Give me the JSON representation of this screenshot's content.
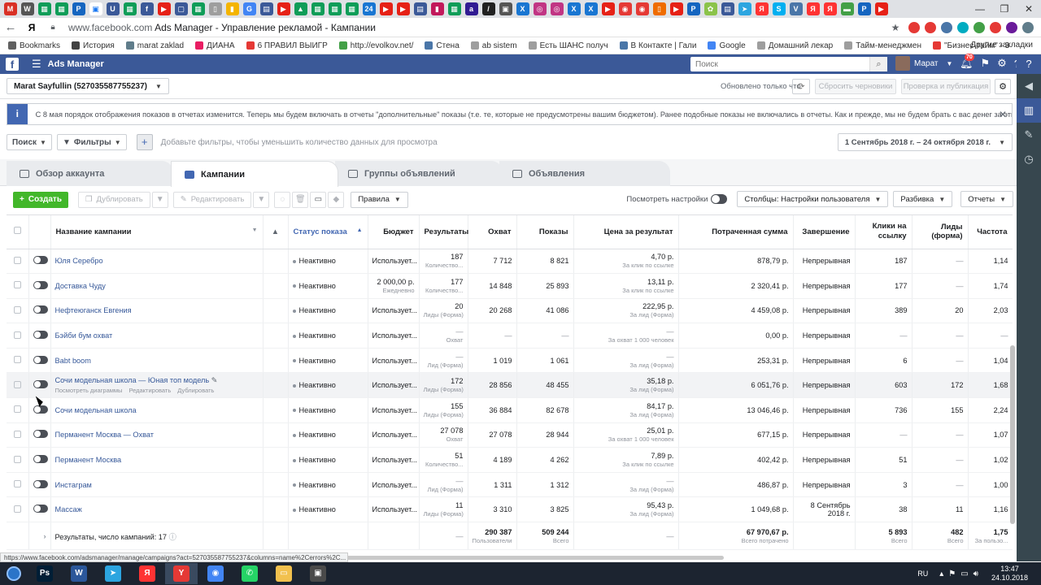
{
  "browser": {
    "tab_favicons": [
      {
        "icon": "gmail-icon",
        "color": "#d93025",
        "glyph": "M"
      },
      {
        "icon": "w-icon",
        "color": "#555555",
        "glyph": "W"
      },
      {
        "icon": "sheets-icon",
        "color": "#0f9d58",
        "glyph": "▦"
      },
      {
        "icon": "sheets-icon",
        "color": "#0f9d58",
        "glyph": "▦"
      },
      {
        "icon": "p-icon",
        "color": "#1565c0",
        "glyph": "P"
      },
      {
        "icon": "active-tab-icon",
        "color": "#1877f2",
        "glyph": "▣",
        "active": true
      },
      {
        "icon": "u-icon",
        "color": "#3b5998",
        "glyph": "U"
      },
      {
        "icon": "sheets-icon",
        "color": "#0f9d58",
        "glyph": "▦"
      },
      {
        "icon": "facebook-icon",
        "color": "#3b5998",
        "glyph": "f"
      },
      {
        "icon": "youtube-icon",
        "color": "#e62117",
        "glyph": "▶"
      },
      {
        "icon": "chat-icon",
        "color": "#3b5998",
        "glyph": "▢"
      },
      {
        "icon": "sheets-icon",
        "color": "#0f9d58",
        "glyph": "▦"
      },
      {
        "icon": "doc-icon",
        "color": "#9e9e9e",
        "glyph": "▯"
      },
      {
        "icon": "analytics-icon",
        "color": "#f4b400",
        "glyph": "▮"
      },
      {
        "icon": "google-icon",
        "color": "#4285f4",
        "glyph": "G"
      },
      {
        "icon": "cal-icon",
        "color": "#3b5998",
        "glyph": "▤"
      },
      {
        "icon": "youtube-icon",
        "color": "#e62117",
        "glyph": "▶"
      },
      {
        "icon": "drive-icon",
        "color": "#0f9d58",
        "glyph": "▲"
      },
      {
        "icon": "sheets-icon",
        "color": "#0f9d58",
        "glyph": "▦"
      },
      {
        "icon": "sheets-icon",
        "color": "#0f9d58",
        "glyph": "▦"
      },
      {
        "icon": "sheets-icon",
        "color": "#0f9d58",
        "glyph": "▦"
      },
      {
        "icon": "24-icon",
        "color": "#1976d2",
        "glyph": "24"
      },
      {
        "icon": "youtube-icon",
        "color": "#e62117",
        "glyph": "▶"
      },
      {
        "icon": "youtube-icon",
        "color": "#e62117",
        "glyph": "▶"
      },
      {
        "icon": "cal-icon",
        "color": "#3b5998",
        "glyph": "▤"
      },
      {
        "icon": "chart-icon",
        "color": "#c2185b",
        "glyph": "▮"
      },
      {
        "icon": "sheets-icon",
        "color": "#0f9d58",
        "glyph": "▦"
      },
      {
        "icon": "ab-icon",
        "color": "#311b92",
        "glyph": "a"
      },
      {
        "icon": "slash-icon",
        "color": "#212121",
        "glyph": "/"
      },
      {
        "icon": "lock-icon",
        "color": "#555555",
        "glyph": "▣"
      },
      {
        "icon": "x-icon",
        "color": "#1976d2",
        "glyph": "X"
      },
      {
        "icon": "instagram-icon",
        "color": "#c13584",
        "glyph": "◎"
      },
      {
        "icon": "instagram-icon",
        "color": "#c13584",
        "glyph": "◎"
      },
      {
        "icon": "x-icon",
        "color": "#1976d2",
        "glyph": "X"
      },
      {
        "icon": "x-icon",
        "color": "#1976d2",
        "glyph": "X"
      },
      {
        "icon": "youtube-icon",
        "color": "#e62117",
        "glyph": "▶"
      },
      {
        "icon": "record-icon",
        "color": "#e53935",
        "glyph": "◉"
      },
      {
        "icon": "record-icon",
        "color": "#e53935",
        "glyph": "◉"
      },
      {
        "icon": "bag-icon",
        "color": "#ef6c00",
        "glyph": "▯"
      },
      {
        "icon": "youtube-icon",
        "color": "#e62117",
        "glyph": "▶"
      },
      {
        "icon": "p-icon",
        "color": "#1565c0",
        "glyph": "P"
      },
      {
        "icon": "photos-icon",
        "color": "#8bc34a",
        "glyph": "✿"
      },
      {
        "icon": "cal-icon",
        "color": "#3b5998",
        "glyph": "▤"
      },
      {
        "icon": "telegram-icon",
        "color": "#2ca5e0",
        "glyph": "➤"
      },
      {
        "icon": "yandex-icon",
        "color": "#ff3333",
        "glyph": "Я"
      },
      {
        "icon": "skype-icon",
        "color": "#00aff0",
        "glyph": "S"
      },
      {
        "icon": "vk-icon",
        "color": "#4a76a8",
        "glyph": "V"
      },
      {
        "icon": "yandex-icon",
        "color": "#ff3333",
        "glyph": "Я"
      },
      {
        "icon": "yandex-icon",
        "color": "#ff3333",
        "glyph": "Я"
      },
      {
        "icon": "green-icon",
        "color": "#43a047",
        "glyph": "▬"
      },
      {
        "icon": "p-icon",
        "color": "#1565c0",
        "glyph": "P"
      },
      {
        "icon": "youtube-icon",
        "color": "#e62117",
        "glyph": "▶"
      }
    ],
    "window_controls": [
      "—",
      "❐",
      "✕"
    ],
    "address_prefix": "Я",
    "url_host": "www.facebook.com",
    "url_rest": " Ads Manager - Управление рекламой - Кампании",
    "bookmarks": [
      {
        "label": "Bookmarks",
        "color": "#616161"
      },
      {
        "label": "История",
        "color": "#424242"
      },
      {
        "label": "marat zaklad",
        "color": "#607d8b"
      },
      {
        "label": "ДИАНА",
        "color": "#e91e63"
      },
      {
        "label": "6 ПРАВИЛ ВЫИГР",
        "color": "#e53935"
      },
      {
        "label": "http://evolkov.net/",
        "color": "#43a047"
      },
      {
        "label": "Стена",
        "color": "#4a76a8"
      },
      {
        "label": "ab sistem",
        "color": "#9e9e9e"
      },
      {
        "label": "Есть ШАНС получ",
        "color": "#9e9e9e"
      },
      {
        "label": "В Контакте | Гали",
        "color": "#4a76a8"
      },
      {
        "label": "Google",
        "color": "#4285f4"
      },
      {
        "label": "Домашний лекар",
        "color": "#9e9e9e"
      },
      {
        "label": "Тайм-менеджмен",
        "color": "#9e9e9e"
      },
      {
        "label": "\"Бизнес-тайм\" - 3",
        "color": "#e53935"
      }
    ],
    "bookmarks_more": "Другие закладки",
    "status_url": "https://www.facebook.com/adsmanager/manage/campaigns?act=527035587755237&columns=name%2Cerrors%2C..."
  },
  "fb": {
    "app_title": "Ads Manager",
    "search_placeholder": "Поиск",
    "user_name": "Марат",
    "notif_count": "70",
    "brand_color": "#3b5998"
  },
  "account": {
    "name": "Marat Sayfullin (527035587755237)",
    "updated": "Обновлено только что",
    "discard": "Сбросить черновики",
    "review": "Проверка и публикация"
  },
  "banner": {
    "text": "С 8 мая порядок отображения показов в отчетах изменится. Теперь мы будем включать в отчеты \"дополнительные\" показы (т.е. те, которые не предусмотрены вашим бюджетом). Ранее подобные показы не включались в отчеты. Как и прежде, мы не будем брать с вас денег за эти дополнительные показы."
  },
  "filters": {
    "search": "Поиск",
    "filters": "Фильтры",
    "hint": "Добавьте фильтры, чтобы уменьшить количество данных для просмотра",
    "date_range": "1 Сентябрь 2018 г. – 24 октября 2018 г."
  },
  "level_tabs": [
    "Обзор аккаунта",
    "Кампании",
    "Группы объявлений",
    "Объявления"
  ],
  "toolbar": {
    "create": "Создать",
    "duplicate": "Дублировать",
    "edit": "Редактировать",
    "rules": "Правила",
    "view_settings": "Посмотреть настройки",
    "columns": "Столбцы: Настройки пользователя",
    "breakdown": "Разбивка",
    "reports": "Отчеты"
  },
  "table": {
    "headers": [
      "Название кампании",
      "Статус показа",
      "Бюджет",
      "Результаты",
      "Охват",
      "Показы",
      "Цена за результат",
      "Потраченная сумма",
      "Завершение",
      "Клики на ссылку",
      "Лиды (форма)",
      "Частота"
    ],
    "rows": [
      {
        "name": "Юля Серебро",
        "status": "Неактивно",
        "budget": "Использует...",
        "budget_sub": "",
        "results": "187",
        "results_sub": "Количество...",
        "reach": "7 712",
        "impr": "8 821",
        "cpr": "4,70 р.",
        "cpr_sub": "За клик по ссылке",
        "spent": "878,79 р.",
        "end": "Непрерывная",
        "clicks": "187",
        "leads": "—",
        "freq": "1,14"
      },
      {
        "name": "Доставка Чуду",
        "status": "Неактивно",
        "budget": "2 000,00 р.",
        "budget_sub": "Ежедневно",
        "results": "177",
        "results_sub": "Количество...",
        "reach": "14 848",
        "impr": "25 893",
        "cpr": "13,11 р.",
        "cpr_sub": "За клик по ссылке",
        "spent": "2 320,41 р.",
        "end": "Непрерывная",
        "clicks": "177",
        "leads": "—",
        "freq": "1,74"
      },
      {
        "name": "Нефтеюганск Евгения",
        "status": "Неактивно",
        "budget": "Использует...",
        "budget_sub": "",
        "results": "20",
        "results_sub": "Лиды (Форма)",
        "reach": "20 268",
        "impr": "41 086",
        "cpr": "222,95 р.",
        "cpr_sub": "За лид (Форма)",
        "spent": "4 459,08 р.",
        "end": "Непрерывная",
        "clicks": "389",
        "leads": "20",
        "freq": "2,03"
      },
      {
        "name": "Бэйби бум охват",
        "status": "Неактивно",
        "budget": "Использует...",
        "budget_sub": "",
        "results": "—",
        "results_sub": "Охват",
        "reach": "—",
        "impr": "—",
        "cpr": "—",
        "cpr_sub": "За охват 1 000 человек",
        "spent": "0,00 р.",
        "end": "Непрерывная",
        "clicks": "—",
        "leads": "—",
        "freq": "—"
      },
      {
        "name": "Babt boom",
        "status": "Неактивно",
        "budget": "Использует...",
        "budget_sub": "",
        "results": "—",
        "results_sub": "Лид (Форма)",
        "reach": "1 019",
        "impr": "1 061",
        "cpr": "—",
        "cpr_sub": "За лид (Форма)",
        "spent": "253,31 р.",
        "end": "Непрерывная",
        "clicks": "6",
        "leads": "—",
        "freq": "1,04"
      },
      {
        "name": "Сочи модельная школа — Юная топ модель",
        "status": "Неактивно",
        "budget": "Использует...",
        "budget_sub": "",
        "results": "172",
        "results_sub": "Лиды (Форма)",
        "reach": "28 856",
        "impr": "48 455",
        "cpr": "35,18 р.",
        "cpr_sub": "За лид (Форма)",
        "spent": "6 051,76 р.",
        "end": "Непрерывная",
        "clicks": "603",
        "leads": "172",
        "freq": "1,68",
        "hover": true
      },
      {
        "name": "Сочи модельная школа",
        "status": "Неактивно",
        "budget": "Использует...",
        "budget_sub": "",
        "results": "155",
        "results_sub": "Лиды (Форма)",
        "reach": "36 884",
        "impr": "82 678",
        "cpr": "84,17 р.",
        "cpr_sub": "За лид (Форма)",
        "spent": "13 046,46 р.",
        "end": "Непрерывная",
        "clicks": "736",
        "leads": "155",
        "freq": "2,24"
      },
      {
        "name": "Перманент Москва — Охват",
        "status": "Неактивно",
        "budget": "Использует...",
        "budget_sub": "",
        "results": "27 078",
        "results_sub": "Охват",
        "reach": "27 078",
        "impr": "28 944",
        "cpr": "25,01 р.",
        "cpr_sub": "За охват 1 000 человек",
        "spent": "677,15 р.",
        "end": "Непрерывная",
        "clicks": "—",
        "leads": "—",
        "freq": "1,07"
      },
      {
        "name": "Перманент Москва",
        "status": "Неактивно",
        "budget": "Использует...",
        "budget_sub": "",
        "results": "51",
        "results_sub": "Количество...",
        "reach": "4 189",
        "impr": "4 262",
        "cpr": "7,89 р.",
        "cpr_sub": "За клик по ссылке",
        "spent": "402,42 р.",
        "end": "Непрерывная",
        "clicks": "51",
        "leads": "—",
        "freq": "1,02"
      },
      {
        "name": "Инстаграм",
        "status": "Неактивно",
        "budget": "Использует...",
        "budget_sub": "",
        "results": "—",
        "results_sub": "Лид (Форма)",
        "reach": "1 311",
        "impr": "1 312",
        "cpr": "—",
        "cpr_sub": "За лид (Форма)",
        "spent": "486,87 р.",
        "end": "Непрерывная",
        "clicks": "3",
        "leads": "—",
        "freq": "1,00"
      },
      {
        "name": "Массаж",
        "status": "Неактивно",
        "budget": "Использует...",
        "budget_sub": "",
        "results": "11",
        "results_sub": "Лиды (Форма)",
        "reach": "3 310",
        "impr": "3 825",
        "cpr": "95,43 р.",
        "cpr_sub": "За лид (Форма)",
        "spent": "1 049,68 р.",
        "end": "8 Сентябрь 2018 г.",
        "clicks": "38",
        "leads": "11",
        "freq": "1,16"
      }
    ],
    "hover_actions": [
      "Посмотреть диаграммы",
      "Редактировать",
      "Дублировать"
    ],
    "totals": {
      "label": "Результаты, число кампаний: 17",
      "results": "—",
      "reach": "290 387",
      "reach_sub": "Пользователи",
      "impr": "509 244",
      "impr_sub": "Всего",
      "cpr": "—",
      "spent": "67 970,67 р.",
      "spent_sub": "Всего потрачено",
      "clicks": "5 893",
      "clicks_sub": "Всего",
      "leads": "482",
      "leads_sub": "Всего",
      "freq": "1,75",
      "freq_sub": "За пользо..."
    }
  },
  "taskbar": {
    "apps": [
      {
        "icon": "photoshop-icon",
        "color": "#001e36",
        "glyph": "Ps"
      },
      {
        "icon": "word-icon",
        "color": "#2b579a",
        "glyph": "W"
      },
      {
        "icon": "telegram-icon",
        "color": "#2ca5e0",
        "glyph": "➤"
      },
      {
        "icon": "yandex-browser-icon",
        "color": "#ff3333",
        "glyph": "Я"
      },
      {
        "icon": "yandex-icon",
        "color": "#e53935",
        "glyph": "Y"
      },
      {
        "icon": "chrome-icon",
        "color": "#4285f4",
        "glyph": "◉"
      },
      {
        "icon": "whatsapp-icon",
        "color": "#25d366",
        "glyph": "✆"
      },
      {
        "icon": "explorer-icon",
        "color": "#f2c14e",
        "glyph": "▭"
      },
      {
        "icon": "app-icon",
        "color": "#4a4a4a",
        "glyph": "▣"
      }
    ],
    "lang": "RU",
    "time": "13:47",
    "date": "24.10.2018"
  }
}
